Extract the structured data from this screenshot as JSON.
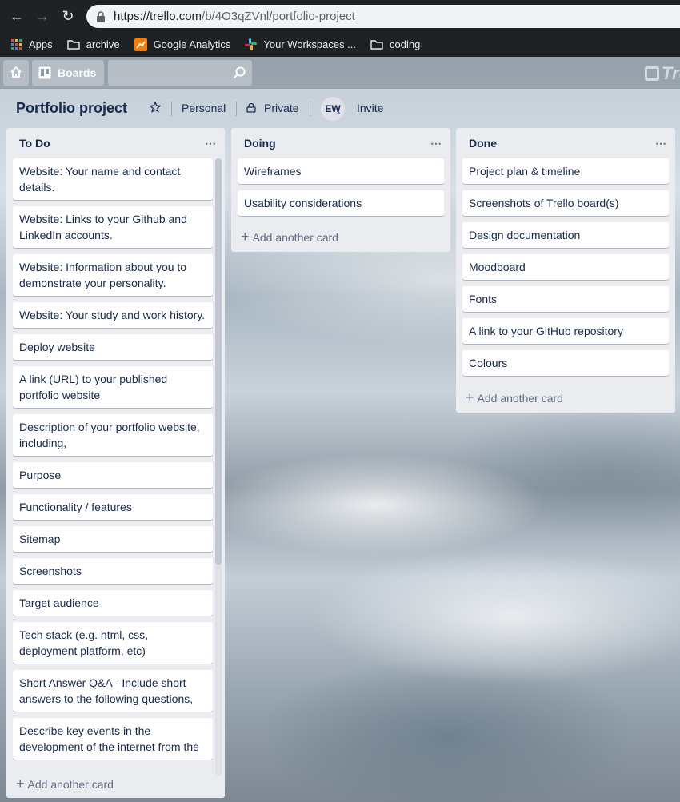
{
  "browser": {
    "url_host": "https://trello.com",
    "url_path": "/b/4O3qZVnl/portfolio-project",
    "bookmarks": [
      "Apps",
      "archive",
      "Google Analytics",
      "Your Workspaces ...",
      "coding"
    ]
  },
  "header": {
    "boards_label": "Boards",
    "logo_text": "Tre"
  },
  "board": {
    "title": "Portfolio project",
    "visibility_team": "Personal",
    "visibility": "Private",
    "avatar_initials": "EW",
    "invite_label": "Invite"
  },
  "lists": [
    {
      "name": "To Do",
      "add_label": "Add another card",
      "cards": [
        "Website: Your name and contact details.",
        "Website: Links to your Github and LinkedIn accounts.",
        "Website: Information about you to demonstrate your personality.",
        "Website: Your study and work history.",
        "Deploy website",
        "A link (URL) to your published portfolio website",
        "Description of your portfolio website, including,",
        "Purpose",
        "Functionality / features",
        "Sitemap",
        "Screenshots",
        "Target audience",
        "Tech stack (e.g. html, css, deployment platform, etc)",
        "Short Answer Q&A - Include short answers to the following questions,",
        "Describe key events in the development of the internet from the"
      ]
    },
    {
      "name": "Doing",
      "add_label": "Add another card",
      "cards": [
        "Wireframes",
        "Usability considerations"
      ]
    },
    {
      "name": "Done",
      "add_label": "Add another card",
      "cards": [
        "Project plan & timeline",
        "Screenshots of Trello board(s)",
        "Design documentation",
        "Moodboard",
        "Fonts",
        "A link to your GitHub repository",
        "Colours"
      ]
    }
  ]
}
